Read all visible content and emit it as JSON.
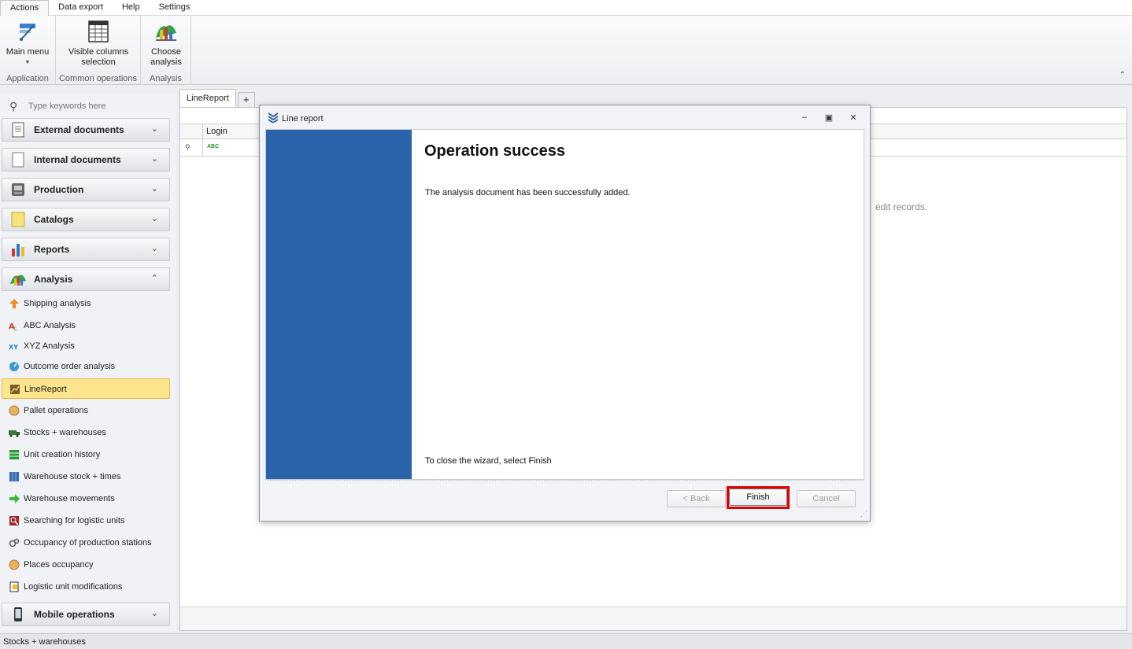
{
  "menu": {
    "tabs": [
      "Actions",
      "Data export",
      "Help",
      "Settings"
    ]
  },
  "ribbon": {
    "groups": [
      {
        "label": "Application",
        "buttons": [
          {
            "label": "Main menu"
          }
        ]
      },
      {
        "label": "Common operations",
        "buttons": [
          {
            "label": "Visible columns\nselection"
          }
        ]
      },
      {
        "label": "Analysis",
        "buttons": [
          {
            "label": "Choose\nanalysis"
          }
        ]
      }
    ],
    "main_menu_label": "Main menu",
    "visible_columns_label": "Visible columns",
    "visible_columns_label2": "selection",
    "choose_analysis_label": "Choose",
    "choose_analysis_label2": "analysis",
    "group_application": "Application",
    "group_common": "Common operations",
    "group_analysis": "Analysis"
  },
  "search": {
    "placeholder": "Type keywords here"
  },
  "sidebar": {
    "groups": [
      {
        "label": "External documents",
        "expanded": false
      },
      {
        "label": "Internal documents",
        "expanded": false
      },
      {
        "label": "Production",
        "expanded": false
      },
      {
        "label": "Catalogs",
        "expanded": false
      },
      {
        "label": "Reports",
        "expanded": false
      },
      {
        "label": "Analysis",
        "expanded": true
      },
      {
        "label": "Mobile operations",
        "expanded": false
      }
    ],
    "items": [
      {
        "label": "Shipping analysis",
        "icon": "arrow-up-icon"
      },
      {
        "label": "ABC Analysis",
        "icon": "abc-icon"
      },
      {
        "label": "XYZ Analysis",
        "icon": "xyz-icon"
      },
      {
        "label": "Outcome order analysis",
        "icon": "gauge-icon"
      },
      {
        "label": "LineReport",
        "icon": "line-report-icon",
        "selected": true
      },
      {
        "label": "Pallet operations",
        "icon": "pallet-icon"
      },
      {
        "label": "Stocks + warehouses",
        "icon": "truck-icon"
      },
      {
        "label": "Unit creation history",
        "icon": "table-green-icon"
      },
      {
        "label": "Warehouse stock + times",
        "icon": "warehouse-icon"
      },
      {
        "label": "Warehouse movements",
        "icon": "arrow-right-icon"
      },
      {
        "label": "Searching for logistic units",
        "icon": "search-red-icon"
      },
      {
        "label": "Occupancy of production stations",
        "icon": "gears-icon"
      },
      {
        "label": "Places occupancy",
        "icon": "pallet-icon"
      },
      {
        "label": "Logistic unit modifications",
        "icon": "edit-doc-icon"
      }
    ]
  },
  "doc_tabs": {
    "active": "LineReport",
    "add": "+"
  },
  "grid": {
    "columns": [
      "Login"
    ],
    "filter_abc": "ABC",
    "hint": "edit records."
  },
  "status": {
    "text": "Stocks + warehouses"
  },
  "dialog": {
    "title": "Line report",
    "heading": "Operation success",
    "message": "The analysis document has been successfully added.",
    "footer_message": "To close the wizard, select Finish",
    "back_label": "< Back",
    "finish_label": "Finish",
    "cancel_label": "Cancel"
  },
  "colors": {
    "dialog_side": "#2a64aa",
    "selected_item": "#fde58d",
    "highlight": "#e00000"
  }
}
